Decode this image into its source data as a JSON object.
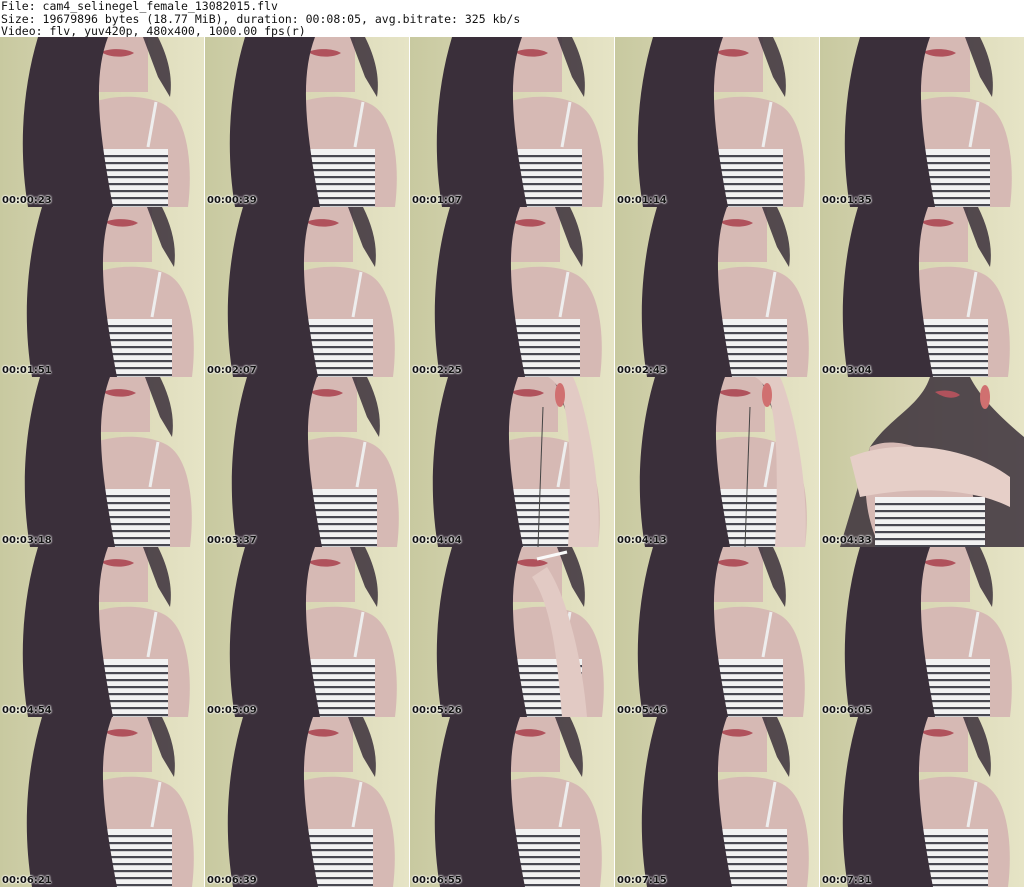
{
  "header": {
    "line1": "File: cam4_selinegel_female_13082015.flv",
    "line2": "Size: 19679896 bytes (18.77 MiB), duration: 00:08:05, avg.bitrate: 325 kb/s",
    "line3": "Video: flv, yuv420p, 480x400, 1000.00 fps(r)"
  },
  "thumbnails": [
    {
      "timestamp": "00:00:23",
      "variant": "normal"
    },
    {
      "timestamp": "00:00:39",
      "variant": "normal"
    },
    {
      "timestamp": "00:01:07",
      "variant": "normal"
    },
    {
      "timestamp": "00:01:14",
      "variant": "normal"
    },
    {
      "timestamp": "00:01:35",
      "variant": "normal"
    },
    {
      "timestamp": "00:01:51",
      "variant": "normal"
    },
    {
      "timestamp": "00:02:07",
      "variant": "normal"
    },
    {
      "timestamp": "00:02:25",
      "variant": "normal"
    },
    {
      "timestamp": "00:02:43",
      "variant": "normal"
    },
    {
      "timestamp": "00:03:04",
      "variant": "normal"
    },
    {
      "timestamp": "00:03:18",
      "variant": "normal"
    },
    {
      "timestamp": "00:03:37",
      "variant": "normal"
    },
    {
      "timestamp": "00:04:04",
      "variant": "phone"
    },
    {
      "timestamp": "00:04:13",
      "variant": "phone"
    },
    {
      "timestamp": "00:04:33",
      "variant": "phone-arm"
    },
    {
      "timestamp": "00:04:54",
      "variant": "normal"
    },
    {
      "timestamp": "00:05:09",
      "variant": "normal"
    },
    {
      "timestamp": "00:05:26",
      "variant": "cigarette"
    },
    {
      "timestamp": "00:05:46",
      "variant": "normal"
    },
    {
      "timestamp": "00:06:05",
      "variant": "normal"
    },
    {
      "timestamp": "00:06:21",
      "variant": "normal"
    },
    {
      "timestamp": "00:06:39",
      "variant": "normal"
    },
    {
      "timestamp": "00:06:55",
      "variant": "normal"
    },
    {
      "timestamp": "00:07:15",
      "variant": "normal"
    },
    {
      "timestamp": "00:07:31",
      "variant": "normal"
    }
  ],
  "colors": {
    "wall": "#d9d7b4",
    "skin": "#d6b9b4",
    "hair": "#3a2f3a",
    "lips": "#b0525c",
    "stripe": "#2a2a35",
    "top": "#f2f2f2",
    "phone": "#d07070"
  }
}
